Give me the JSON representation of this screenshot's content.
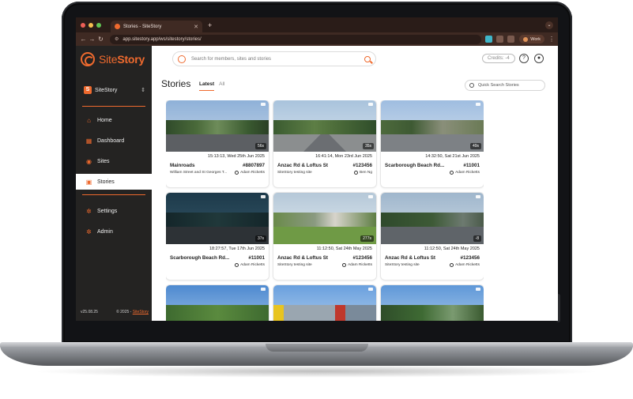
{
  "browser": {
    "tab_title": "Stories - SiteStory",
    "url": "app.sitestory.app/ws/sitestory/stories/",
    "profile": "Work"
  },
  "brand": {
    "site": "Site",
    "story": "Story",
    "accent": "#ef6a2e"
  },
  "sidebar": {
    "workspace": {
      "badge": "S",
      "name": "SiteStory"
    },
    "items": [
      {
        "label": "Home",
        "icon": "home-icon",
        "glyph": "⌂"
      },
      {
        "label": "Dashboard",
        "icon": "dashboard-icon",
        "glyph": "▦"
      },
      {
        "label": "Sites",
        "icon": "map-pin-icon",
        "glyph": "◉"
      },
      {
        "label": "Stories",
        "icon": "stories-icon",
        "glyph": "▣"
      },
      {
        "label": "Settings",
        "icon": "gear-icon",
        "glyph": "✲"
      },
      {
        "label": "Admin",
        "icon": "admin-icon",
        "glyph": "✲"
      }
    ],
    "version": "v25.08.25",
    "copyright": "© 2025 - ",
    "copyright_link": "SiteStory"
  },
  "header": {
    "search_placeholder": "Search for members, sites and stories",
    "credits": "Credits: -4"
  },
  "page": {
    "title": "Stories",
    "tabs": [
      "Latest",
      "All"
    ],
    "quick_search": "Quick Search Stories"
  },
  "stories": [
    {
      "date": "15:13:13, Wed 25th Jun 2025",
      "title": "Mainroads",
      "id": "#8807897",
      "subtitle": "William Street and St Georges T...",
      "user": "Adam Ricketts",
      "duration": "56s"
    },
    {
      "date": "16:41:14, Mon 23rd Jun 2025",
      "title": "Anzac Rd & Loftus St",
      "id": "#123456",
      "subtitle": "SiteStory testing site",
      "user": "Ben Ng",
      "duration": "35s"
    },
    {
      "date": "14:32:50, Sat 21st Jun 2025",
      "title": "Scarborough Beach Rd...",
      "id": "#11001",
      "subtitle": "",
      "user": "Adam Ricketts",
      "duration": "49s"
    },
    {
      "date": "18:27:57, Tue 17th Jun 2025",
      "title": "Scarborough Beach Rd...",
      "id": "#11001",
      "subtitle": "",
      "user": "Adam Ricketts",
      "duration": "37s"
    },
    {
      "date": "11:12:50, Sat 24th May 2025",
      "title": "Anzac Rd & Loftus St",
      "id": "#123456",
      "subtitle": "SiteStory testing site",
      "user": "Adam Ricketts",
      "duration": "277s"
    },
    {
      "date": "11:12:50, Sat 24th May 2025",
      "title": "Anzac Rd & Loftus St",
      "id": "#123456",
      "subtitle": "SiteStory testing site",
      "user": "Adam Ricketts",
      "duration": "-8"
    },
    {
      "date": "",
      "title": "",
      "id": "",
      "subtitle": "",
      "user": "",
      "duration": ""
    },
    {
      "date": "",
      "title": "",
      "id": "",
      "subtitle": "",
      "user": "",
      "duration": ""
    },
    {
      "date": "",
      "title": "",
      "id": "",
      "subtitle": "",
      "user": "",
      "duration": ""
    }
  ]
}
